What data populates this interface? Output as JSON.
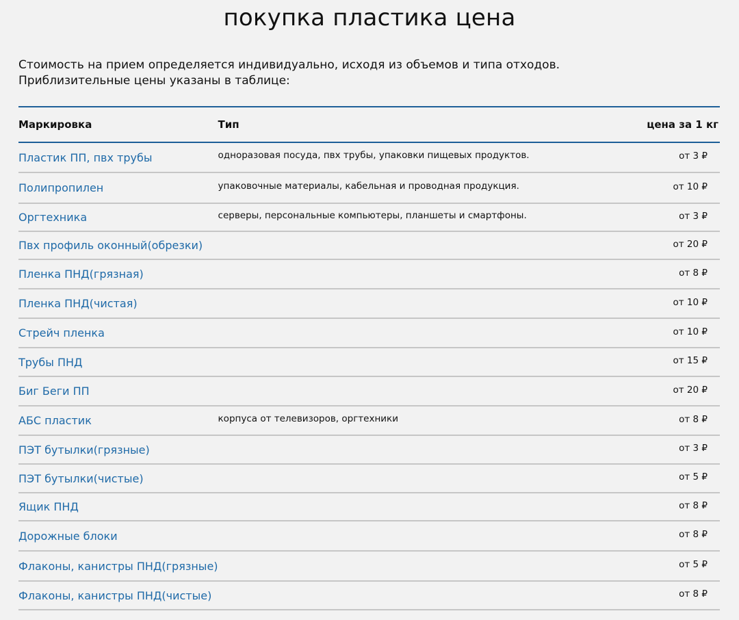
{
  "title": "покупка пластика цена",
  "intro": {
    "line1": "Стоимость на прием определяется индивидуально, исходя из объемов и типа отходов.",
    "line2": "Приблизительные цены указаны в таблице:"
  },
  "table": {
    "headers": {
      "mark": "Маркировка",
      "type": "Тип",
      "price": "цена за 1 кг"
    },
    "rows": [
      {
        "mark": "Пластик ПП, пвх трубы",
        "type": "одноразовая посуда, пвх трубы, упаковки пищевых продуктов.",
        "price": "от 3 ₽"
      },
      {
        "mark": "Полипропилен",
        "type": "упаковочные материалы, кабельная и проводная продукция.",
        "price": "от 10 ₽"
      },
      {
        "mark": "Оргтехника",
        "type": "серверы, персональные компьютеры, планшеты и смартфоны.",
        "price": "от 3 ₽"
      },
      {
        "mark": "Пвх профиль оконный(обрезки)",
        "type": "",
        "price": "от 20 ₽"
      },
      {
        "mark": "Пленка ПНД(грязная)",
        "type": "",
        "price": "от 8 ₽"
      },
      {
        "mark": "Пленка ПНД(чистая)",
        "type": "",
        "price": "от 10 ₽"
      },
      {
        "mark": "Стрейч пленка",
        "type": "",
        "price": "от 10 ₽"
      },
      {
        "mark": "Трубы ПНД",
        "type": "",
        "price": "от 15 ₽"
      },
      {
        "mark": "Биг Беги ПП",
        "type": "",
        "price": "от 20 ₽"
      },
      {
        "mark": "АБС пластик",
        "type": "корпуса от телевизоров, оргтехники",
        "price": "от 8 ₽"
      },
      {
        "mark": "ПЭТ бутылки(грязные)",
        "type": "",
        "price": "от 3 ₽"
      },
      {
        "mark": "ПЭТ бутылки(чистые)",
        "type": "",
        "price": "от 5 ₽"
      },
      {
        "mark": "Ящик ПНД",
        "type": "",
        "price": "от 8 ₽"
      },
      {
        "mark": "Дорожные блоки",
        "type": "",
        "price": "от 8 ₽"
      },
      {
        "mark": "Флаконы, канистры ПНД(грязные)",
        "type": "",
        "price": "от 5 ₽"
      },
      {
        "mark": "Флаконы, канистры ПНД(чистые)",
        "type": "",
        "price": "от 8 ₽"
      }
    ]
  },
  "colors": {
    "link": "#1f6aa8",
    "header_rule": "#1d5f98",
    "row_rule": "#c6c6c6",
    "background": "#f2f2f2"
  }
}
